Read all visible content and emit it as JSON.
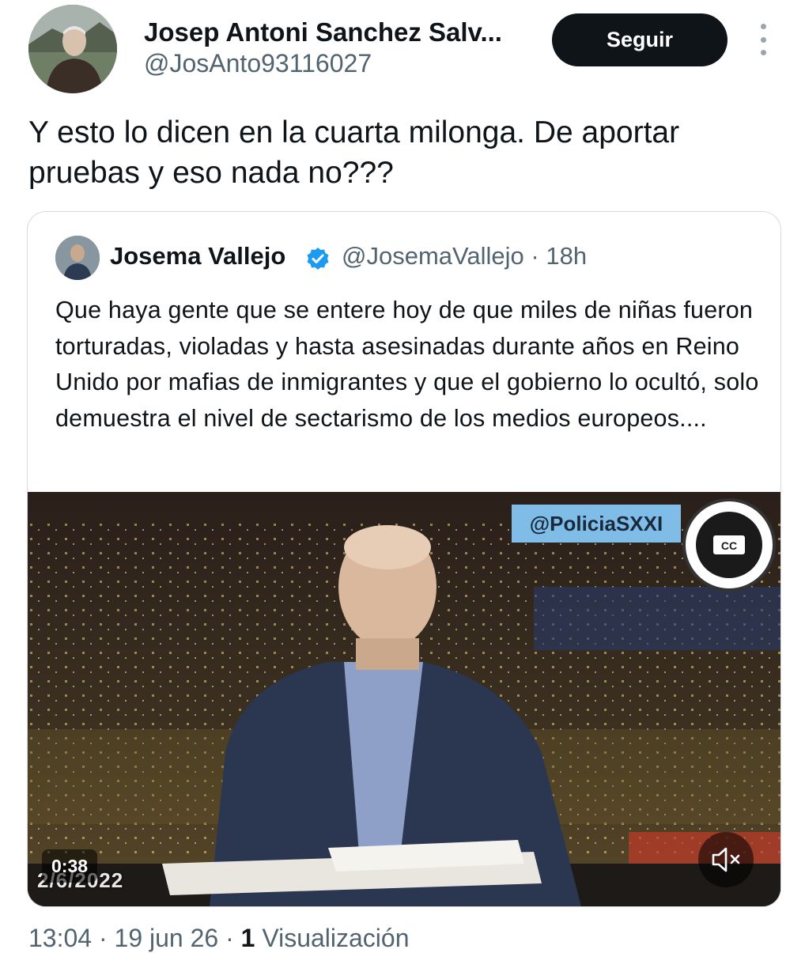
{
  "author": {
    "name": "Josep Antoni Sanchez Salv...",
    "handle": "@JosAnto93116027",
    "follow_label": "Seguir"
  },
  "tweet": {
    "text": "Y esto lo dicen en la cuarta milonga. De aportar pruebas y eso nada no???",
    "time": "13:04",
    "date": "19 jun 26",
    "views_count": "1",
    "views_label": "Visualización"
  },
  "quoted_tweet": {
    "name": "Josema Vallejo",
    "handle": "@JosemaVallejo",
    "age": "18h",
    "text": "Que haya gente que se entere hoy de que miles de niñas fueron torturadas, violadas y hasta asesinadas durante años en Reino Unido por mafias de inmigrantes y que el gobierno lo ocultó, solo demuestra el nivel de sectarismo de los medios europeos....",
    "video": {
      "duration": "0:38",
      "date_stamp": "2/6/2022",
      "watermark": "@PoliciaSXXI",
      "logo_text": "CC"
    }
  },
  "icons": {
    "more": "more-vertical-icon",
    "verified": "verified-badge-icon",
    "mute": "volume-muted-icon"
  },
  "colors": {
    "primary_text": "#0f1419",
    "secondary_text": "#536471",
    "verified_blue": "#1d9bf0",
    "button_bg": "#0f1419",
    "border": "#d6dbe0"
  }
}
